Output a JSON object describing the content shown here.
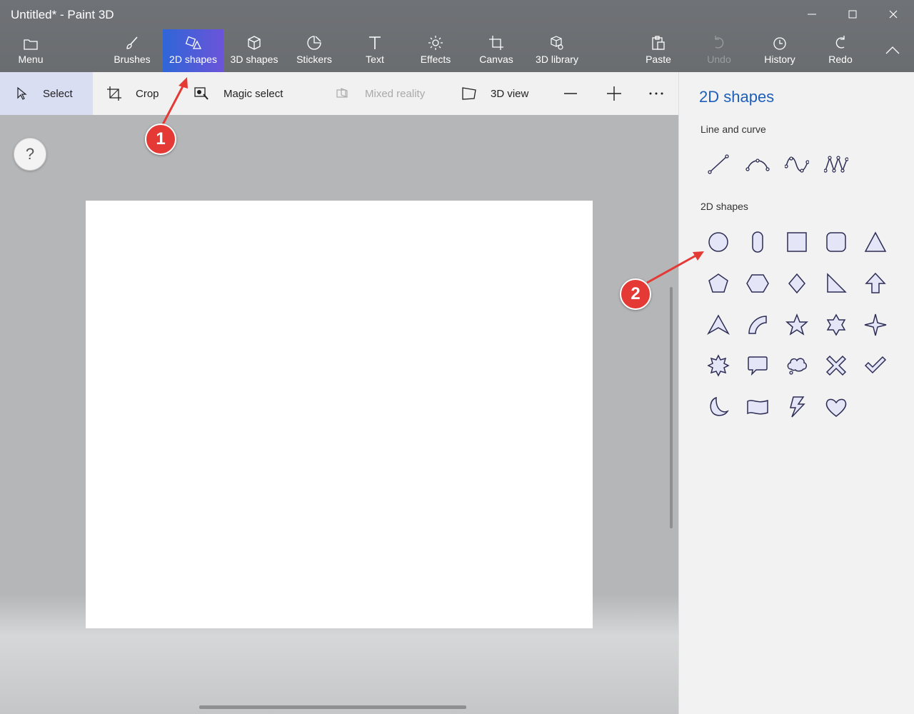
{
  "window": {
    "title": "Untitled* - Paint 3D"
  },
  "ribbon": {
    "menu": "Menu",
    "brushes": "Brushes",
    "shapes2d": "2D shapes",
    "shapes3d": "3D shapes",
    "stickers": "Stickers",
    "text": "Text",
    "effects": "Effects",
    "canvas": "Canvas",
    "library3d": "3D library",
    "paste": "Paste",
    "undo": "Undo",
    "history": "History",
    "redo": "Redo"
  },
  "toolbar": {
    "select": "Select",
    "crop": "Crop",
    "magic_select": "Magic select",
    "mixed_reality": "Mixed reality",
    "view3d": "3D view",
    "help": "?"
  },
  "panel": {
    "title": "2D shapes",
    "line_section": "Line and curve",
    "shapes_section": "2D shapes"
  },
  "annotations": {
    "badge1": "1",
    "badge2": "2"
  },
  "colors": {
    "accent": "#1f5fb8",
    "active_tool": "#4a5fd9",
    "annotation": "#e53935"
  },
  "icons": {
    "line_curve": [
      "line",
      "curve",
      "s-curve",
      "zigzag-curve"
    ],
    "shapes": [
      "circle",
      "pill",
      "square",
      "rounded-square",
      "triangle",
      "pentagon",
      "hexagon",
      "diamond",
      "right-triangle",
      "up-arrow",
      "arrowhead",
      "quarter-circle",
      "five-point-star",
      "six-point-star",
      "four-point-star",
      "burst",
      "speech-bubble",
      "thought-cloud",
      "x-mark",
      "check-mark",
      "moon",
      "banner",
      "lightning",
      "heart"
    ]
  }
}
